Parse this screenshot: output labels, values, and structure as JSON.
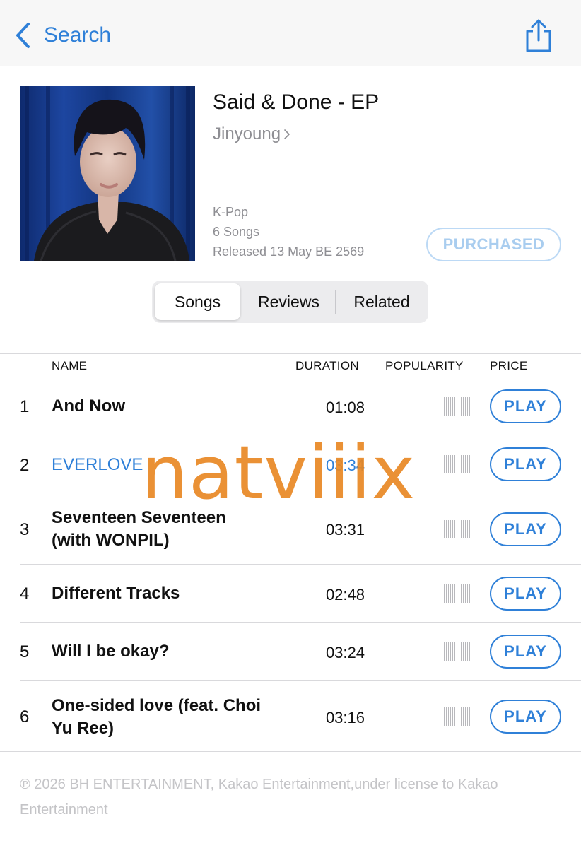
{
  "nav": {
    "back_label": "Search"
  },
  "album": {
    "title": "Said & Done - EP",
    "artist": "Jinyoung",
    "genre": "K-Pop",
    "song_count": "6 Songs",
    "released": "Released 13 May BE 2569",
    "purchase_label": "PURCHASED"
  },
  "tabs": [
    {
      "label": "Songs",
      "selected": true
    },
    {
      "label": "Reviews",
      "selected": false
    },
    {
      "label": "Related",
      "selected": false
    }
  ],
  "table": {
    "headers": {
      "name": "NAME",
      "duration": "DURATION",
      "popularity": "POPULARITY",
      "price": "PRICE"
    },
    "rows": [
      {
        "num": "1",
        "name": "And Now",
        "duration": "01:08",
        "price_label": "PLAY"
      },
      {
        "num": "2",
        "name": "EVERLOVE",
        "duration": "03:34",
        "price_label": "PLAY"
      },
      {
        "num": "3",
        "name": "Seventeen  Seventeen (with WONPIL)",
        "duration": "03:31",
        "price_label": "PLAY"
      },
      {
        "num": "4",
        "name": "Different Tracks",
        "duration": "02:48",
        "price_label": "PLAY"
      },
      {
        "num": "5",
        "name": "Will I be okay?",
        "duration": "03:24",
        "price_label": "PLAY"
      },
      {
        "num": "6",
        "name": "One-sided love (feat. Choi Yu Ree)",
        "duration": "03:16",
        "price_label": "PLAY"
      }
    ]
  },
  "copyright": "℗ 2026 BH ENTERTAINMENT, Kakao Entertainment,under license to Kakao Entertainment",
  "watermark": "natviiix",
  "colors": {
    "accent": "#2f80d8",
    "secondary_text": "#8e8e93",
    "watermark": "#e88824"
  },
  "icons": {
    "back": "chevron-left-icon",
    "share": "share-icon",
    "artist_link": "chevron-right-icon"
  }
}
